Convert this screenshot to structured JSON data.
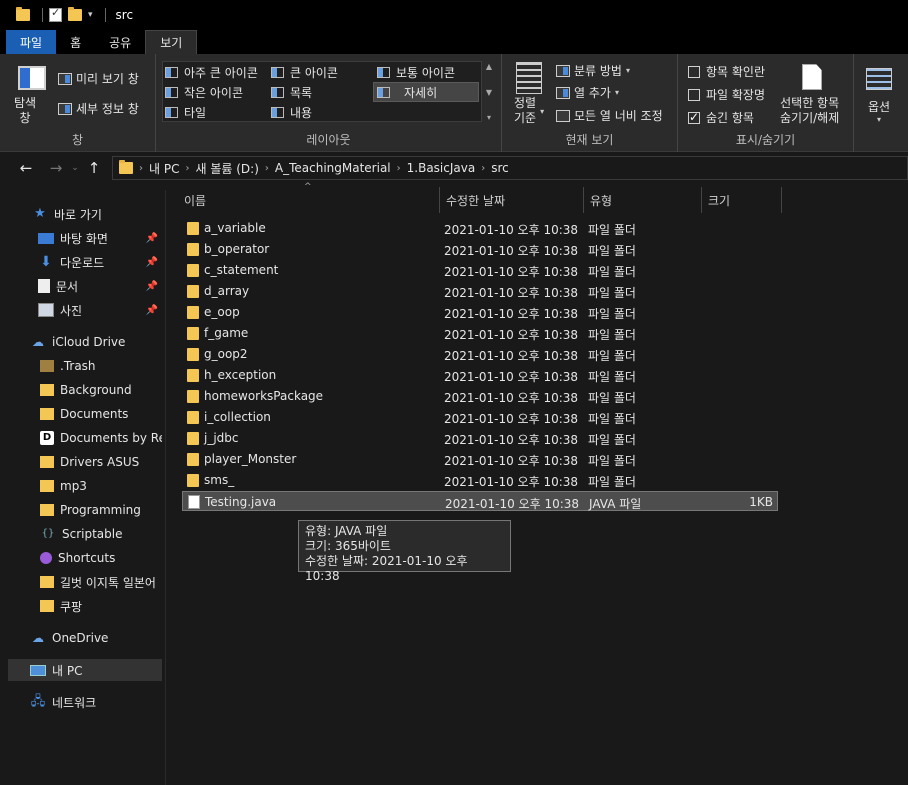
{
  "window": {
    "title": "src"
  },
  "tabs": [
    "파일",
    "홈",
    "공유",
    "보기"
  ],
  "ribbon": {
    "pane": {
      "nav_pane": "탐색\n창",
      "preview": "미리 보기 창",
      "details": "세부 정보 창",
      "label": "창"
    },
    "layout": {
      "items": [
        "아주 큰 아이콘",
        "큰 아이콘",
        "보통 아이콘",
        "작은 아이콘",
        "목록",
        "자세히",
        "타일",
        "내용"
      ],
      "selected": "자세히",
      "label": "레이아웃"
    },
    "current_view": {
      "sort": "정렬\n기준",
      "group_by": "분류 방법",
      "add_columns": "열 추가",
      "size_all_columns": "모든 열 너비 조정",
      "label": "현재 보기"
    },
    "show_hide": {
      "item_checkboxes": "항목 확인란",
      "file_extensions": "파일 확장명",
      "hidden_items": "숨긴 항목",
      "hide_selected": "선택한 항목\n숨기기/해제",
      "label": "표시/숨기기",
      "checks": {
        "item_checkboxes": false,
        "file_extensions": false,
        "hidden_items": true
      }
    },
    "options": "옵션"
  },
  "breadcrumb": [
    "내 PC",
    "새 볼륨 (D:)",
    "A_TeachingMaterial",
    "1.BasicJava",
    "src"
  ],
  "nav": {
    "quick_access": "바로 가기",
    "pinned": [
      "바탕 화면",
      "다운로드",
      "문서",
      "사진"
    ],
    "icloud": "iCloud Drive",
    "icloud_items": [
      ".Trash",
      "Background",
      "Documents",
      "Documents by Rea",
      "Drivers ASUS",
      "mp3",
      "Programming",
      "Scriptable",
      "Shortcuts",
      "길벗 이지톡 일본어",
      "쿠팡"
    ],
    "onedrive": "OneDrive",
    "this_pc": "내 PC",
    "network": "네트워크"
  },
  "columns": {
    "name": "이름",
    "modified": "수정한 날짜",
    "type": "유형",
    "size": "크기"
  },
  "files": [
    {
      "name": "a_variable",
      "modified": "2021-01-10 오후 10:38",
      "type": "파일 폴더",
      "size": "",
      "kind": "folder"
    },
    {
      "name": "b_operator",
      "modified": "2021-01-10 오후 10:38",
      "type": "파일 폴더",
      "size": "",
      "kind": "folder"
    },
    {
      "name": "c_statement",
      "modified": "2021-01-10 오후 10:38",
      "type": "파일 폴더",
      "size": "",
      "kind": "folder"
    },
    {
      "name": "d_array",
      "modified": "2021-01-10 오후 10:38",
      "type": "파일 폴더",
      "size": "",
      "kind": "folder"
    },
    {
      "name": "e_oop",
      "modified": "2021-01-10 오후 10:38",
      "type": "파일 폴더",
      "size": "",
      "kind": "folder"
    },
    {
      "name": "f_game",
      "modified": "2021-01-10 오후 10:38",
      "type": "파일 폴더",
      "size": "",
      "kind": "folder"
    },
    {
      "name": "g_oop2",
      "modified": "2021-01-10 오후 10:38",
      "type": "파일 폴더",
      "size": "",
      "kind": "folder"
    },
    {
      "name": "h_exception",
      "modified": "2021-01-10 오후 10:38",
      "type": "파일 폴더",
      "size": "",
      "kind": "folder"
    },
    {
      "name": "homeworksPackage",
      "modified": "2021-01-10 오후 10:38",
      "type": "파일 폴더",
      "size": "",
      "kind": "folder"
    },
    {
      "name": "i_collection",
      "modified": "2021-01-10 오후 10:38",
      "type": "파일 폴더",
      "size": "",
      "kind": "folder"
    },
    {
      "name": "j_jdbc",
      "modified": "2021-01-10 오후 10:38",
      "type": "파일 폴더",
      "size": "",
      "kind": "folder"
    },
    {
      "name": "player_Monster",
      "modified": "2021-01-10 오후 10:38",
      "type": "파일 폴더",
      "size": "",
      "kind": "folder"
    },
    {
      "name": "sms_",
      "modified": "2021-01-10 오후 10:38",
      "type": "파일 폴더",
      "size": "",
      "kind": "folder"
    },
    {
      "name": "Testing.java",
      "modified": "2021-01-10 오후 10:38",
      "type": "JAVA 파일",
      "size": "1KB",
      "kind": "file"
    }
  ],
  "tooltip": {
    "type": "유형: JAVA 파일",
    "size": "크기: 365바이트",
    "modified": "수정한 날짜: 2021-01-10 오후 10:38"
  }
}
